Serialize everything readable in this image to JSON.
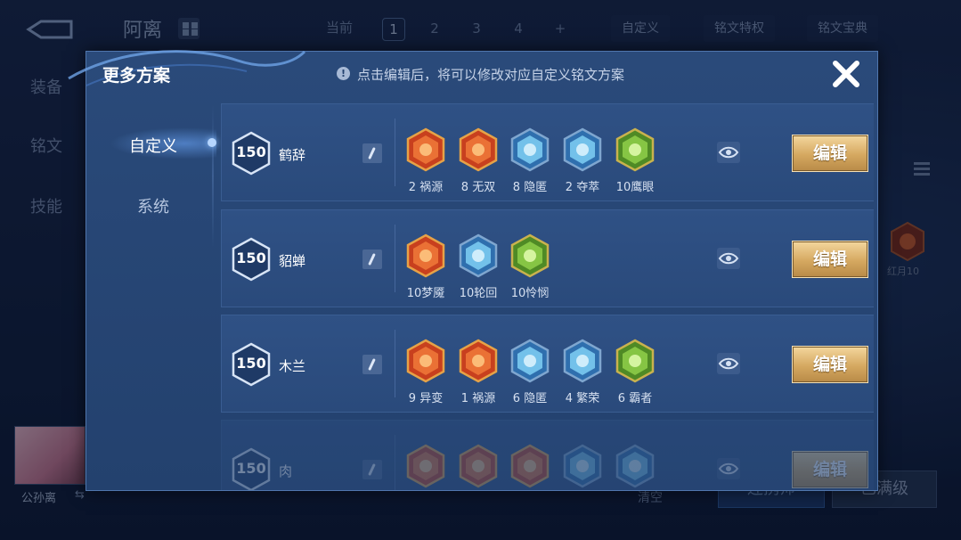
{
  "background": {
    "hero_name": "阿离",
    "plan_tabs": {
      "current_label": "当前",
      "pages": [
        "1",
        "2",
        "3",
        "4"
      ],
      "add_label": "+"
    },
    "top_buttons": {
      "custom": "自定义",
      "privilege": "铭文特权",
      "handbook": "铭文宝典"
    },
    "left_tabs": [
      "装备",
      "铭文",
      "技能"
    ],
    "right_rune_label": "红月10",
    "hero_portrait_label": "公孙离",
    "bottom_text": "清空",
    "bottom_buttons": [
      "连携师",
      "已满级"
    ]
  },
  "modal": {
    "title": "更多方案",
    "hint": "点击编辑后，将可以修改对应自定义铭文方案",
    "side_tabs": [
      {
        "label": "自定义",
        "active": true
      },
      {
        "label": "系统",
        "active": false
      }
    ],
    "rows": [
      {
        "level": "150",
        "name": "鹤辞",
        "edit_label": "编辑",
        "runes": [
          {
            "icon": "rune-red-scroll",
            "label": "2 祸源"
          },
          {
            "icon": "rune-red-hex",
            "label": "8 无双"
          },
          {
            "icon": "rune-blue-flame",
            "label": "8 隐匿"
          },
          {
            "icon": "rune-blue-knot",
            "label": "2 夺萃"
          },
          {
            "icon": "rune-green-clover",
            "label": "10鹰眼"
          }
        ]
      },
      {
        "level": "150",
        "name": "貂蝉",
        "edit_label": "编辑",
        "runes": [
          {
            "icon": "rune-red-flower",
            "label": "10梦魇"
          },
          {
            "icon": "rune-blue-swirl",
            "label": "10轮回"
          },
          {
            "icon": "rune-green-star",
            "label": "10怜悯"
          }
        ]
      },
      {
        "level": "150",
        "name": "木兰",
        "edit_label": "编辑",
        "runes": [
          {
            "icon": "rune-red-shield",
            "label": "9 异变"
          },
          {
            "icon": "rune-red-scroll",
            "label": "1 祸源"
          },
          {
            "icon": "rune-blue-flame",
            "label": "6 隐匿"
          },
          {
            "icon": "rune-blue-star",
            "label": "4 繁荣"
          },
          {
            "icon": "rune-green-shield",
            "label": "6 霸者"
          }
        ]
      },
      {
        "level": "150",
        "name": "肉",
        "edit_label": "编辑",
        "runes": [
          {
            "icon": "rune-red-flower",
            "label": ""
          },
          {
            "icon": "rune-red-hex",
            "label": ""
          },
          {
            "icon": "rune-red-scroll",
            "label": ""
          },
          {
            "icon": "rune-blue-knot",
            "label": ""
          },
          {
            "icon": "rune-blue-star",
            "label": ""
          }
        ]
      }
    ]
  },
  "colors": {
    "rune_red": "#c8401e",
    "rune_blue": "#4a9ad8",
    "rune_green": "#6fa83a",
    "edit_gold": "#d5a860"
  }
}
